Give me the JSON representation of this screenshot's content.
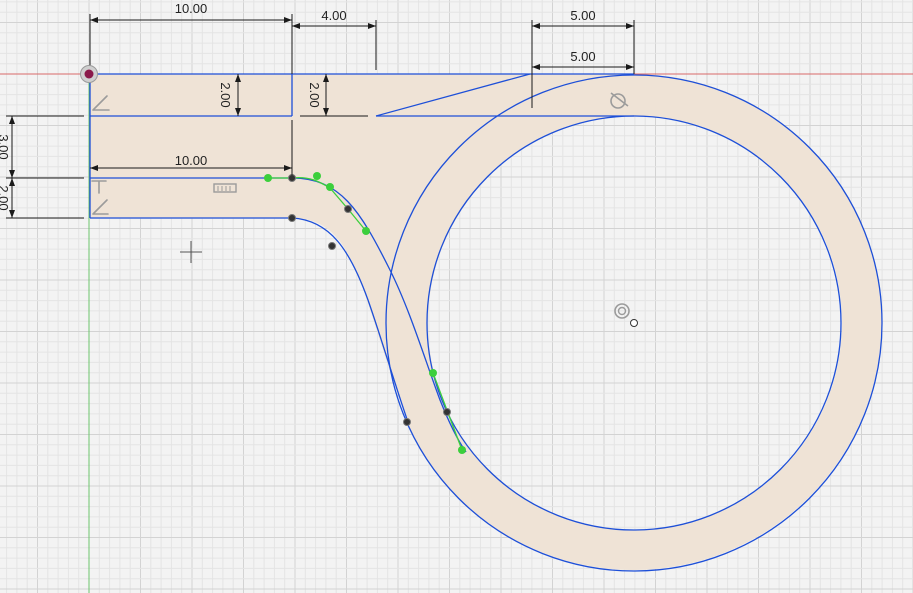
{
  "colors": {
    "background": "#f3f3f3",
    "grid_minor": "#e4e4e4",
    "grid_major": "#d3d3d3",
    "x_axis": "#d96a6a",
    "y_axis": "#6cc56c",
    "profile_fill": "#efe3d6",
    "sketch_line": "#1d4fd8",
    "spline_handle": "#3ccf3c",
    "spline_point": "#333333",
    "origin_point": "#8a1a4a"
  },
  "dimensions": {
    "top_width": "10.00",
    "gap_width": "4.00",
    "inner_width": "10.00",
    "left_height": "2.00",
    "mid_height": "2.00",
    "cut_upper": "3.00",
    "cut_lower": "2.00",
    "circle_upper": "5.00",
    "circle_lower": "5.00"
  },
  "icons": {
    "origin": "origin-point-icon",
    "perpendicular_1": "perpendicular-constraint-icon",
    "perpendicular_2": "perpendicular-constraint-icon",
    "perpendicular_3": "perpendicular-constraint-icon",
    "tangent": "tangent-constraint-icon",
    "curvature": "curvature-constraint-icon",
    "concentric": "concentric-constraint-icon",
    "cursor": "crosshair-cursor-icon"
  }
}
